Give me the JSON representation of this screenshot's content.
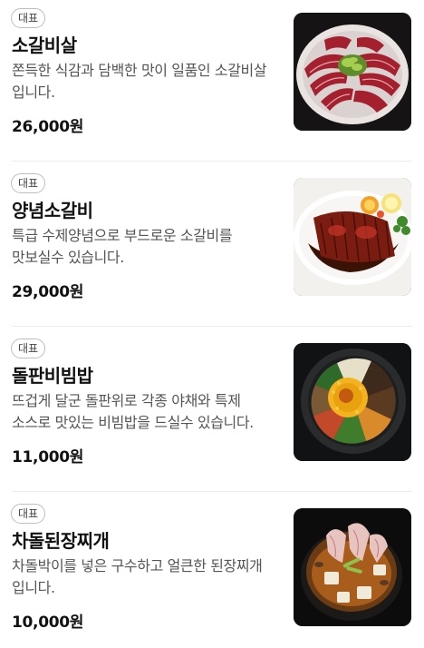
{
  "menu_items": [
    {
      "badge": "대표",
      "name": "소갈비살",
      "description": "쫀득한 식감과 담백한 맛이 일품인 소갈비살 입니다.",
      "price": "26,000원",
      "image": "grilled-beef-rib-plate"
    },
    {
      "badge": "대표",
      "name": "양념소갈비",
      "description": "특급 수제양념으로 부드로운 소갈비를 맛보실수 있습니다.",
      "price": "29,000원",
      "image": "marinated-beef-rib-plate"
    },
    {
      "badge": "대표",
      "name": "돌판비빔밥",
      "description": "뜨겁게 달군 돌판위로 각종 야채와 특제 소스로 맛있는 비빔밥을 드실수 있습니다.",
      "price": "11,000원",
      "image": "stone-pot-bibimbap"
    },
    {
      "badge": "대표",
      "name": "차돌된장찌개",
      "description": "차돌박이를 넣은 구수하고 얼큰한 된장찌개 입니다.",
      "price": "10,000원",
      "image": "brisket-soybean-stew"
    }
  ]
}
